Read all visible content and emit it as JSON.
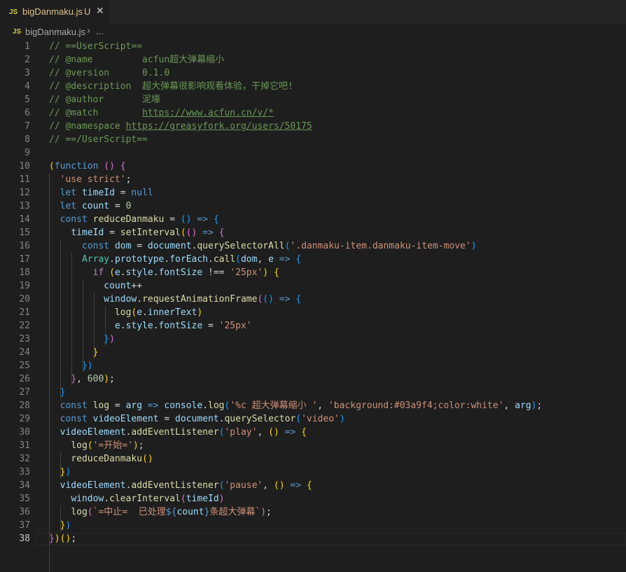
{
  "tab": {
    "icon_label": "JS",
    "filename": "bigDanmaku.js",
    "modified_badge": "U",
    "close_symbol": "✕"
  },
  "breadcrumb": {
    "icon_label": "JS",
    "file": "bigDanmaku.js",
    "separator": "›",
    "more": "..."
  },
  "editor": {
    "active_line": 38,
    "lines": [
      [
        [
          "c",
          "// ==UserScript=="
        ]
      ],
      [
        [
          "c",
          "// @name         acfun超大弹幕缩小"
        ]
      ],
      [
        [
          "c",
          "// @version      0.1.0"
        ]
      ],
      [
        [
          "c",
          "// @description  超大弹幕很影响观看体验，干掉它吧!"
        ]
      ],
      [
        [
          "c",
          "// @author       泥壕"
        ]
      ],
      [
        [
          "c",
          "// @match        "
        ],
        [
          "cu",
          "https://www.acfun.cn/v/*"
        ]
      ],
      [
        [
          "c",
          "// @namespace "
        ],
        [
          "cu",
          "https://greasyfork.org/users/50175"
        ]
      ],
      [
        [
          "c",
          "// ==/UserScript=="
        ]
      ],
      [],
      [
        [
          "br1",
          "("
        ],
        [
          "kw",
          "function"
        ],
        [
          "p",
          " "
        ],
        [
          "br2",
          "()"
        ],
        [
          "p",
          " "
        ],
        [
          "br2",
          "{"
        ]
      ],
      [
        [
          "p",
          "  "
        ],
        [
          "str",
          "'use strict'"
        ],
        [
          "p",
          ";"
        ]
      ],
      [
        [
          "p",
          "  "
        ],
        [
          "kw",
          "let"
        ],
        [
          "p",
          " "
        ],
        [
          "var",
          "timeId"
        ],
        [
          "p",
          " = "
        ],
        [
          "kw",
          "null"
        ]
      ],
      [
        [
          "p",
          "  "
        ],
        [
          "kw",
          "let"
        ],
        [
          "p",
          " "
        ],
        [
          "var",
          "count"
        ],
        [
          "p",
          " = "
        ],
        [
          "num",
          "0"
        ]
      ],
      [
        [
          "p",
          "  "
        ],
        [
          "kw",
          "const"
        ],
        [
          "p",
          " "
        ],
        [
          "fn",
          "reduceDanmaku"
        ],
        [
          "p",
          " = "
        ],
        [
          "br3",
          "()"
        ],
        [
          "p",
          " "
        ],
        [
          "kw",
          "=>"
        ],
        [
          "p",
          " "
        ],
        [
          "br3",
          "{"
        ]
      ],
      [
        [
          "p",
          "    "
        ],
        [
          "var",
          "timeId"
        ],
        [
          "p",
          " = "
        ],
        [
          "fn",
          "setInterval"
        ],
        [
          "br1",
          "("
        ],
        [
          "br2",
          "()"
        ],
        [
          "p",
          " "
        ],
        [
          "kw",
          "=>"
        ],
        [
          "p",
          " "
        ],
        [
          "br2",
          "{"
        ]
      ],
      [
        [
          "p",
          "      "
        ],
        [
          "kw",
          "const"
        ],
        [
          "p",
          " "
        ],
        [
          "var",
          "dom"
        ],
        [
          "p",
          " = "
        ],
        [
          "var",
          "document"
        ],
        [
          "p",
          "."
        ],
        [
          "fn",
          "querySelectorAll"
        ],
        [
          "br3",
          "("
        ],
        [
          "str",
          "'.danmaku-item.danmaku-item-move'"
        ],
        [
          "br3",
          ")"
        ]
      ],
      [
        [
          "p",
          "      "
        ],
        [
          "cls",
          "Array"
        ],
        [
          "p",
          "."
        ],
        [
          "var",
          "prototype"
        ],
        [
          "p",
          "."
        ],
        [
          "var",
          "forEach"
        ],
        [
          "p",
          "."
        ],
        [
          "fn",
          "call"
        ],
        [
          "br3",
          "("
        ],
        [
          "var",
          "dom"
        ],
        [
          "p",
          ", "
        ],
        [
          "var",
          "e"
        ],
        [
          "p",
          " "
        ],
        [
          "kw",
          "=>"
        ],
        [
          "p",
          " "
        ],
        [
          "br3",
          "{"
        ]
      ],
      [
        [
          "p",
          "        "
        ],
        [
          "kc",
          "if"
        ],
        [
          "p",
          " "
        ],
        [
          "br1",
          "("
        ],
        [
          "var",
          "e"
        ],
        [
          "p",
          "."
        ],
        [
          "var",
          "style"
        ],
        [
          "p",
          "."
        ],
        [
          "var",
          "fontSize"
        ],
        [
          "p",
          " !== "
        ],
        [
          "str",
          "'25px'"
        ],
        [
          "br1",
          ")"
        ],
        [
          "p",
          " "
        ],
        [
          "br1",
          "{"
        ]
      ],
      [
        [
          "p",
          "          "
        ],
        [
          "var",
          "count"
        ],
        [
          "p",
          "++"
        ]
      ],
      [
        [
          "p",
          "          "
        ],
        [
          "var",
          "window"
        ],
        [
          "p",
          "."
        ],
        [
          "fn",
          "requestAnimationFrame"
        ],
        [
          "br2",
          "("
        ],
        [
          "br3",
          "()"
        ],
        [
          "p",
          " "
        ],
        [
          "kw",
          "=>"
        ],
        [
          "p",
          " "
        ],
        [
          "br3",
          "{"
        ]
      ],
      [
        [
          "p",
          "            "
        ],
        [
          "fn",
          "log"
        ],
        [
          "br1",
          "("
        ],
        [
          "var",
          "e"
        ],
        [
          "p",
          "."
        ],
        [
          "var",
          "innerText"
        ],
        [
          "br1",
          ")"
        ]
      ],
      [
        [
          "p",
          "            "
        ],
        [
          "var",
          "e"
        ],
        [
          "p",
          "."
        ],
        [
          "var",
          "style"
        ],
        [
          "p",
          "."
        ],
        [
          "var",
          "fontSize"
        ],
        [
          "p",
          " = "
        ],
        [
          "str",
          "'25px'"
        ]
      ],
      [
        [
          "p",
          "          "
        ],
        [
          "br3",
          "}"
        ],
        [
          "br2",
          ")"
        ]
      ],
      [
        [
          "p",
          "        "
        ],
        [
          "br1",
          "}"
        ]
      ],
      [
        [
          "p",
          "      "
        ],
        [
          "br3",
          "})"
        ]
      ],
      [
        [
          "p",
          "    "
        ],
        [
          "br2",
          "}"
        ],
        [
          "p",
          ", "
        ],
        [
          "num",
          "600"
        ],
        [
          "br1",
          ")"
        ],
        [
          "p",
          ";"
        ]
      ],
      [
        [
          "p",
          "  "
        ],
        [
          "br3",
          "}"
        ]
      ],
      [
        [
          "p",
          "  "
        ],
        [
          "kw",
          "const"
        ],
        [
          "p",
          " "
        ],
        [
          "fn",
          "log"
        ],
        [
          "p",
          " = "
        ],
        [
          "var",
          "arg"
        ],
        [
          "p",
          " "
        ],
        [
          "kw",
          "=>"
        ],
        [
          "p",
          " "
        ],
        [
          "var",
          "console"
        ],
        [
          "p",
          "."
        ],
        [
          "fn",
          "log"
        ],
        [
          "br3",
          "("
        ],
        [
          "str",
          "'%c 超大弹幕缩小 '"
        ],
        [
          "p",
          ", "
        ],
        [
          "str",
          "'background:#03a9f4;color:white'"
        ],
        [
          "p",
          ", "
        ],
        [
          "var",
          "arg"
        ],
        [
          "br3",
          ")"
        ],
        [
          "p",
          ";"
        ]
      ],
      [
        [
          "p",
          "  "
        ],
        [
          "kw",
          "const"
        ],
        [
          "p",
          " "
        ],
        [
          "var",
          "videoElement"
        ],
        [
          "p",
          " = "
        ],
        [
          "var",
          "document"
        ],
        [
          "p",
          "."
        ],
        [
          "fn",
          "querySelector"
        ],
        [
          "br3",
          "("
        ],
        [
          "str",
          "'video'"
        ],
        [
          "br3",
          ")"
        ]
      ],
      [
        [
          "p",
          "  "
        ],
        [
          "var",
          "videoElement"
        ],
        [
          "p",
          "."
        ],
        [
          "fn",
          "addEventListener"
        ],
        [
          "br3",
          "("
        ],
        [
          "str",
          "'play'"
        ],
        [
          "p",
          ", "
        ],
        [
          "br1",
          "()"
        ],
        [
          "p",
          " "
        ],
        [
          "kw",
          "=>"
        ],
        [
          "p",
          " "
        ],
        [
          "br1",
          "{"
        ]
      ],
      [
        [
          "p",
          "    "
        ],
        [
          "fn",
          "log"
        ],
        [
          "br1",
          "("
        ],
        [
          "str",
          "'=开始='"
        ],
        [
          "br1",
          ")"
        ],
        [
          "p",
          ";"
        ]
      ],
      [
        [
          "p",
          "    "
        ],
        [
          "fn",
          "reduceDanmaku"
        ],
        [
          "br1",
          "()"
        ]
      ],
      [
        [
          "p",
          "  "
        ],
        [
          "br1",
          "}"
        ],
        [
          "br3",
          ")"
        ]
      ],
      [
        [
          "p",
          "  "
        ],
        [
          "var",
          "videoElement"
        ],
        [
          "p",
          "."
        ],
        [
          "fn",
          "addEventListener"
        ],
        [
          "br3",
          "("
        ],
        [
          "str",
          "'pause'"
        ],
        [
          "p",
          ", "
        ],
        [
          "br1",
          "()"
        ],
        [
          "p",
          " "
        ],
        [
          "kw",
          "=>"
        ],
        [
          "p",
          " "
        ],
        [
          "br1",
          "{"
        ]
      ],
      [
        [
          "p",
          "    "
        ],
        [
          "var",
          "window"
        ],
        [
          "p",
          "."
        ],
        [
          "fn",
          "clearInterval"
        ],
        [
          "br2",
          "("
        ],
        [
          "var",
          "timeId"
        ],
        [
          "br2",
          ")"
        ]
      ],
      [
        [
          "p",
          "    "
        ],
        [
          "fn",
          "log"
        ],
        [
          "br2",
          "("
        ],
        [
          "str",
          "`=中止=  已处理"
        ],
        [
          "kw",
          "${"
        ],
        [
          "var",
          "count"
        ],
        [
          "kw",
          "}"
        ],
        [
          "str",
          "条超大弹幕`"
        ],
        [
          "br2",
          ")"
        ],
        [
          "p",
          ";"
        ]
      ],
      [
        [
          "p",
          "  "
        ],
        [
          "br1",
          "}"
        ],
        [
          "br3",
          ")"
        ]
      ],
      [
        [
          "br2",
          "}"
        ],
        [
          "br1",
          ")"
        ],
        [
          "br1",
          "()"
        ],
        [
          "p",
          ";"
        ]
      ]
    ]
  }
}
